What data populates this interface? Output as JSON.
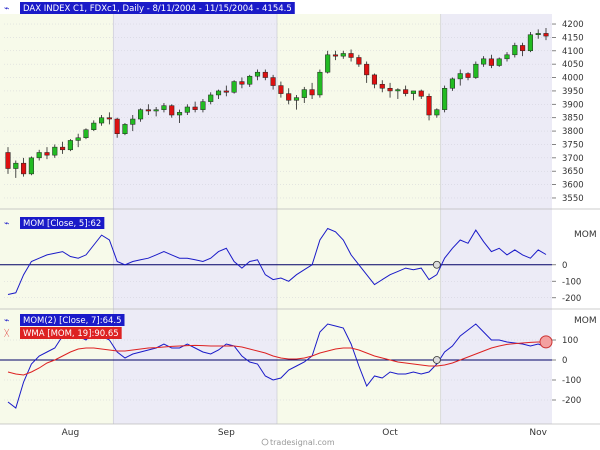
{
  "colors": {
    "band_a": "#f7faea",
    "band_b": "#ecebf6",
    "grid": "#c7c7d0",
    "up": "#22bb22",
    "down": "#dd1111",
    "mom_line": "#1a1ac8",
    "wma_line": "#dd2222",
    "zero_line": "#000066",
    "axis_text": "#333333",
    "label_bg": "#1a1ac8"
  },
  "watermark": "tradesignal.com",
  "chart_data": [
    {
      "type": "candlestick",
      "title": "DAX INDEX C1, FDXc1, Daily - 8/11/2004 - 11/15/2004 - 4154.5",
      "ylim": [
        3520,
        4230
      ],
      "yticks": [
        3550,
        3600,
        3650,
        3700,
        3750,
        3800,
        3850,
        3900,
        3950,
        4000,
        4050,
        4100,
        4150,
        4200
      ],
      "grid": true,
      "x_labels": [
        "Aug",
        "Sep",
        "Oct",
        "Nov"
      ],
      "x_label_index": [
        8,
        28,
        49,
        68
      ],
      "month_boundaries": [
        14,
        35,
        56
      ],
      "ohlc": [
        [
          3720,
          3740,
          3640,
          3660
        ],
        [
          3660,
          3690,
          3625,
          3680
        ],
        [
          3680,
          3700,
          3630,
          3640
        ],
        [
          3640,
          3705,
          3635,
          3700
        ],
        [
          3700,
          3730,
          3690,
          3720
        ],
        [
          3720,
          3740,
          3695,
          3710
        ],
        [
          3710,
          3750,
          3700,
          3740
        ],
        [
          3740,
          3760,
          3715,
          3730
        ],
        [
          3730,
          3770,
          3725,
          3765
        ],
        [
          3765,
          3790,
          3740,
          3775
        ],
        [
          3775,
          3810,
          3770,
          3805
        ],
        [
          3805,
          3840,
          3800,
          3830
        ],
        [
          3830,
          3860,
          3820,
          3850
        ],
        [
          3850,
          3870,
          3825,
          3845
        ],
        [
          3845,
          3850,
          3775,
          3790
        ],
        [
          3790,
          3830,
          3785,
          3825
        ],
        [
          3825,
          3860,
          3800,
          3845
        ],
        [
          3845,
          3885,
          3835,
          3880
        ],
        [
          3880,
          3900,
          3860,
          3875
        ],
        [
          3875,
          3890,
          3855,
          3880
        ],
        [
          3880,
          3905,
          3870,
          3895
        ],
        [
          3895,
          3900,
          3850,
          3860
        ],
        [
          3860,
          3880,
          3830,
          3870
        ],
        [
          3870,
          3900,
          3860,
          3890
        ],
        [
          3890,
          3910,
          3870,
          3880
        ],
        [
          3880,
          3920,
          3870,
          3910
        ],
        [
          3910,
          3945,
          3900,
          3935
        ],
        [
          3935,
          3955,
          3920,
          3950
        ],
        [
          3950,
          3970,
          3930,
          3945
        ],
        [
          3945,
          3990,
          3940,
          3985
        ],
        [
          3985,
          4000,
          3960,
          3975
        ],
        [
          3975,
          4010,
          3965,
          4005
        ],
        [
          4005,
          4030,
          3990,
          4020
        ],
        [
          4020,
          4030,
          3990,
          4000
        ],
        [
          4000,
          4010,
          3955,
          3970
        ],
        [
          3970,
          3985,
          3925,
          3940
        ],
        [
          3940,
          3960,
          3900,
          3915
        ],
        [
          3915,
          3935,
          3880,
          3925
        ],
        [
          3925,
          3965,
          3905,
          3955
        ],
        [
          3955,
          3980,
          3920,
          3935
        ],
        [
          3935,
          4030,
          3925,
          4020
        ],
        [
          4020,
          4100,
          4015,
          4085
        ],
        [
          4085,
          4100,
          4065,
          4080
        ],
        [
          4080,
          4100,
          4070,
          4090
        ],
        [
          4090,
          4105,
          4060,
          4075
        ],
        [
          4075,
          4085,
          4040,
          4050
        ],
        [
          4050,
          4060,
          3980,
          4010
        ],
        [
          4010,
          4015,
          3960,
          3975
        ],
        [
          3975,
          3990,
          3945,
          3960
        ],
        [
          3960,
          3980,
          3925,
          3950
        ],
        [
          3950,
          3960,
          3920,
          3955
        ],
        [
          3955,
          3970,
          3930,
          3940
        ],
        [
          3940,
          3950,
          3915,
          3950
        ],
        [
          3950,
          3955,
          3920,
          3930
        ],
        [
          3930,
          3940,
          3840,
          3860
        ],
        [
          3860,
          3885,
          3850,
          3880
        ],
        [
          3880,
          3970,
          3870,
          3960
        ],
        [
          3960,
          4000,
          3950,
          3995
        ],
        [
          3995,
          4030,
          3970,
          4015
        ],
        [
          4015,
          4020,
          3990,
          4000
        ],
        [
          4000,
          4060,
          3995,
          4050
        ],
        [
          4050,
          4080,
          4040,
          4070
        ],
        [
          4070,
          4085,
          4035,
          4045
        ],
        [
          4045,
          4075,
          4040,
          4070
        ],
        [
          4070,
          4095,
          4060,
          4085
        ],
        [
          4085,
          4130,
          4075,
          4120
        ],
        [
          4120,
          4130,
          4080,
          4100
        ],
        [
          4100,
          4170,
          4095,
          4160
        ],
        [
          4160,
          4180,
          4145,
          4165
        ],
        [
          4165,
          4185,
          4140,
          4155
        ]
      ]
    },
    {
      "type": "line",
      "legend": "MOM [Close, 5]:62",
      "ylabel": "MOM",
      "ylim": [
        -250,
        320
      ],
      "yticks": [
        -200,
        -100,
        0
      ],
      "zero_line": 0,
      "marker_index": 55,
      "series": [
        {
          "values": [
            -180,
            -170,
            -60,
            20,
            40,
            60,
            70,
            80,
            50,
            40,
            60,
            120,
            180,
            150,
            20,
            0,
            20,
            30,
            40,
            60,
            80,
            60,
            40,
            40,
            30,
            20,
            40,
            80,
            100,
            20,
            -20,
            20,
            30,
            -60,
            -90,
            -80,
            -100,
            -60,
            -30,
            0,
            150,
            220,
            200,
            150,
            60,
            0,
            -60,
            -120,
            -90,
            -60,
            -40,
            -20,
            -30,
            -20,
            -90,
            -60,
            40,
            100,
            150,
            130,
            210,
            140,
            80,
            100,
            60,
            90,
            60,
            40,
            90,
            62
          ]
        }
      ]
    },
    {
      "type": "line",
      "legend": [
        "MOM(2) [Close, 7]:64.5",
        "WMA [MOM, 19]:90.65"
      ],
      "ylabel": "MOM",
      "ylim": [
        -300,
        240
      ],
      "yticks": [
        -200,
        -100,
        0,
        100
      ],
      "zero_line": 0,
      "marker_index": 55,
      "series": [
        {
          "values": [
            -210,
            -240,
            -110,
            -20,
            20,
            40,
            60,
            120,
            140,
            120,
            100,
            140,
            120,
            100,
            40,
            10,
            30,
            40,
            50,
            60,
            80,
            60,
            60,
            80,
            60,
            40,
            30,
            50,
            80,
            70,
            20,
            -10,
            -20,
            -80,
            -100,
            -90,
            -50,
            -30,
            -10,
            20,
            140,
            180,
            170,
            160,
            80,
            -30,
            -130,
            -80,
            -90,
            -60,
            -70,
            -70,
            -60,
            -70,
            -60,
            -20,
            40,
            70,
            120,
            150,
            180,
            140,
            100,
            100,
            90,
            85,
            80,
            70,
            80,
            64.5
          ]
        },
        {
          "values": [
            -60,
            -70,
            -75,
            -60,
            -40,
            -15,
            0,
            20,
            40,
            55,
            60,
            60,
            55,
            50,
            45,
            45,
            50,
            55,
            60,
            62,
            65,
            68,
            70,
            72,
            73,
            72,
            70,
            70,
            70,
            70,
            65,
            55,
            45,
            35,
            20,
            10,
            5,
            5,
            10,
            20,
            35,
            45,
            55,
            60,
            60,
            50,
            35,
            20,
            10,
            0,
            -10,
            -15,
            -20,
            -25,
            -30,
            -30,
            -25,
            -15,
            0,
            15,
            30,
            45,
            60,
            70,
            78,
            82,
            85,
            88,
            90,
            90.65
          ]
        }
      ]
    }
  ]
}
